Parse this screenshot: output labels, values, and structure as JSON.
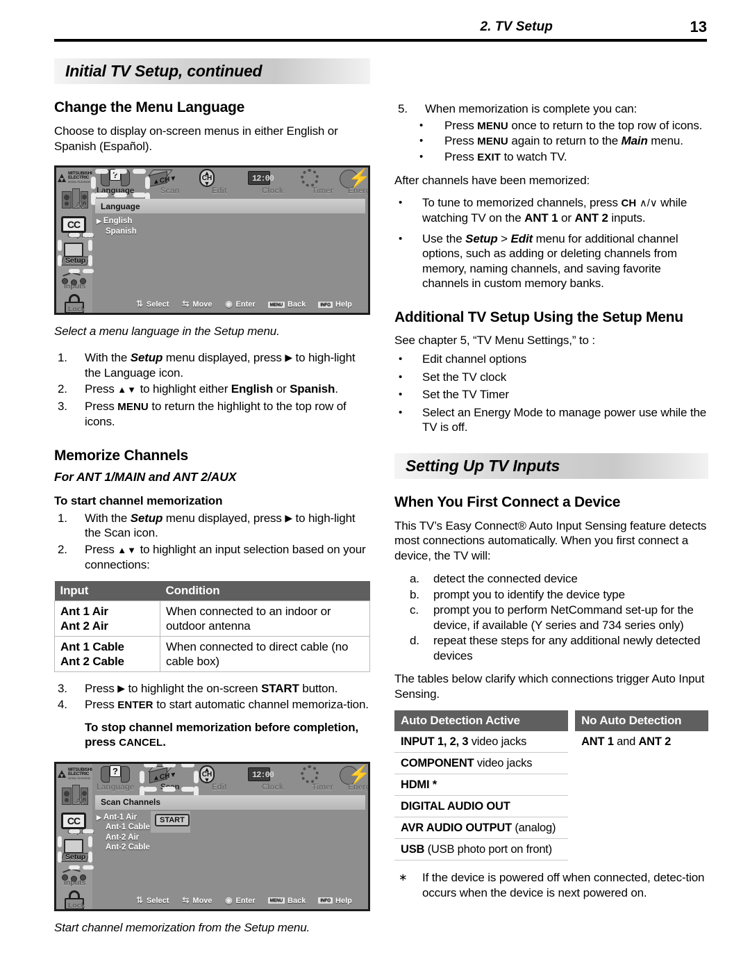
{
  "header": {
    "chapter": "2.  TV Setup",
    "page_number": "13"
  },
  "banners": {
    "left": "Initial TV Setup, continued",
    "right": "Setting Up TV Inputs"
  },
  "left_column": {
    "section1_heading": "Change the Menu Language",
    "section1_body": "Choose to display on-screen menus in either English or Spanish (Español).",
    "figure1_caption": "Select a menu language in the Setup menu.",
    "section1_steps": [
      {
        "num": "1.",
        "parts": [
          "With the ",
          "Setup",
          " menu displayed, press ",
          "▶",
          " to high-light the Language icon."
        ]
      },
      {
        "num": "2.",
        "parts": [
          "Press ",
          "▲▼",
          " to highlight either ",
          "English",
          " or ",
          "Spanish",
          "."
        ]
      },
      {
        "num": "3.",
        "parts": [
          "Press ",
          "MENU",
          " to return the highlight to the top row of icons."
        ]
      }
    ],
    "section2_heading": "Memorize Channels",
    "section2_subheading": "For ANT 1/MAIN and ANT 2/AUX",
    "section2_runin": "To start channel memorization",
    "section2_steps": [
      {
        "num": "1.",
        "text": "With the Setup menu displayed, press ▶ to high-light the Scan icon."
      },
      {
        "num": "2.",
        "text": "Press ▲▼ to highlight an input selection based on your connections:"
      }
    ],
    "input_table": {
      "headers": [
        "Input",
        "Condition"
      ],
      "rows": [
        {
          "input": [
            "Ant 1 Air",
            "Ant 2 Air"
          ],
          "condition": "When connected to an indoor or outdoor antenna"
        },
        {
          "input": [
            "Ant 1 Cable",
            "Ant 2 Cable"
          ],
          "condition": "When connected to direct cable (no cable box)"
        }
      ]
    },
    "section2_steps_cont": [
      {
        "num": "3.",
        "text": "Press ▶ to highlight the on-screen START button."
      },
      {
        "num": "4.",
        "text": "Press ENTER to start automatic channel memoriza-tion."
      }
    ],
    "stop_note": "To stop channel memorization before completion, press CANCEL.",
    "figure2_caption": "Start channel memorization from the Setup menu."
  },
  "right_column": {
    "step5_num": "5.",
    "step5_text": "When memorization is complete you can:",
    "step5_bullets": [
      "Press MENU once to return to the top row of icons.",
      "Press MENU again to return to the Main menu.",
      "Press EXIT to watch TV."
    ],
    "after_intro": "After channels have been memorized:",
    "after_bullets": [
      "To tune to memorized channels, press CH ∧/∨ while watching TV on the ANT 1 or ANT 2 inputs.",
      "Use the Setup > Edit menu for additional channel options, such as adding or deleting channels from memory, naming channels, and saving favorite channels in custom memory banks."
    ],
    "section_heading": "Additional TV Setup Using the Setup Menu",
    "see_chapter": "See chapter 5, “TV Menu Settings,” to :",
    "see_bullets": [
      "Edit channel options",
      "Set the TV clock",
      "Set the TV Timer",
      "Select an Energy Mode to manage power use while the TV is off."
    ],
    "device_heading": "When You First Connect a Device",
    "device_body": "This TV’s Easy Connect® Auto Input Sensing feature detects most connections automatically.  When you first connect a device, the TV will:",
    "device_steps": [
      {
        "letter": "a.",
        "text": "detect the connected device"
      },
      {
        "letter": "b.",
        "text": "prompt you to identify the device type"
      },
      {
        "letter": "c.",
        "text": "prompt you to perform NetCommand set-up for the device, if available (Y series and 734 series only)"
      },
      {
        "letter": "d.",
        "text": "repeat these steps for any additional newly detected devices"
      }
    ],
    "tables_intro": "The tables below clarify which connections trigger Auto Input Sensing.",
    "detection_tables": {
      "active": {
        "header": "Auto Detection Active",
        "rows": [
          {
            "bold": "INPUT 1, 2, 3",
            "rest": " video jacks"
          },
          {
            "bold": "COMPONENT",
            "rest": " video jacks"
          },
          {
            "bold": "HDMI *",
            "rest": ""
          },
          {
            "bold": "DIGITAL AUDIO OUT",
            "rest": ""
          },
          {
            "bold": "AVR AUDIO OUTPUT",
            "rest": " (analog)"
          },
          {
            "bold": "USB",
            "rest": " (USB photo port on front)"
          }
        ]
      },
      "none": {
        "header": "No Auto Detection",
        "rows": [
          {
            "bold": "ANT 1",
            "rest": " and ",
            "bold2": "ANT 2"
          }
        ]
      }
    },
    "footnote": {
      "marker": "∗",
      "text": "If the device is powered off when connected, detec-tion occurs when the device is next powered on."
    }
  },
  "tv_screen_1": {
    "brand_top": "MITSUBISHI",
    "brand_mid": "ELECTRIC",
    "brand_sub": "DIGITAL TELEVISION",
    "rail_labels": [
      "AV",
      "Caption",
      "Setup",
      "Inputs",
      "Lock"
    ],
    "rail_selected": "Setup",
    "top_labels": [
      "Language",
      "Scan",
      "Edit",
      "Clock",
      "Timer",
      "Energy"
    ],
    "top_selected": "Language",
    "clock_digits": "12:00",
    "title": "Language",
    "options": [
      "English",
      "Spanish"
    ],
    "selected_option": "English",
    "hints": [
      {
        "glyph": "select-icon",
        "label": "Select"
      },
      {
        "glyph": "move-icon",
        "label": "Move"
      },
      {
        "glyph": "enter-icon",
        "label": "Enter"
      },
      {
        "glyph": "MENU",
        "label": "Back"
      },
      {
        "glyph": "INFO",
        "label": "Help"
      }
    ]
  },
  "tv_screen_2": {
    "brand_top": "MITSUBISHI",
    "brand_mid": "ELECTRIC",
    "brand_sub": "DIGITAL TELEVISION",
    "rail_labels": [
      "AV",
      "Caption",
      "Setup",
      "Inputs",
      "Lock"
    ],
    "rail_selected": "Setup",
    "top_labels": [
      "Language",
      "Scan",
      "Edit",
      "Clock",
      "Timer",
      "Energy"
    ],
    "top_selected": "Scan",
    "clock_digits": "12:00",
    "title": "Scan Channels",
    "options": [
      "Ant-1 Air",
      "Ant-1 Cable",
      "Ant-2 Air",
      "Ant-2 Cable"
    ],
    "selected_option": "Ant-1 Air",
    "start_button": "START",
    "hints": [
      {
        "glyph": "select-icon",
        "label": "Select"
      },
      {
        "glyph": "move-icon",
        "label": "Move"
      },
      {
        "glyph": "enter-icon",
        "label": "Enter"
      },
      {
        "glyph": "MENU",
        "label": "Back"
      },
      {
        "glyph": "INFO",
        "label": "Help"
      }
    ]
  }
}
